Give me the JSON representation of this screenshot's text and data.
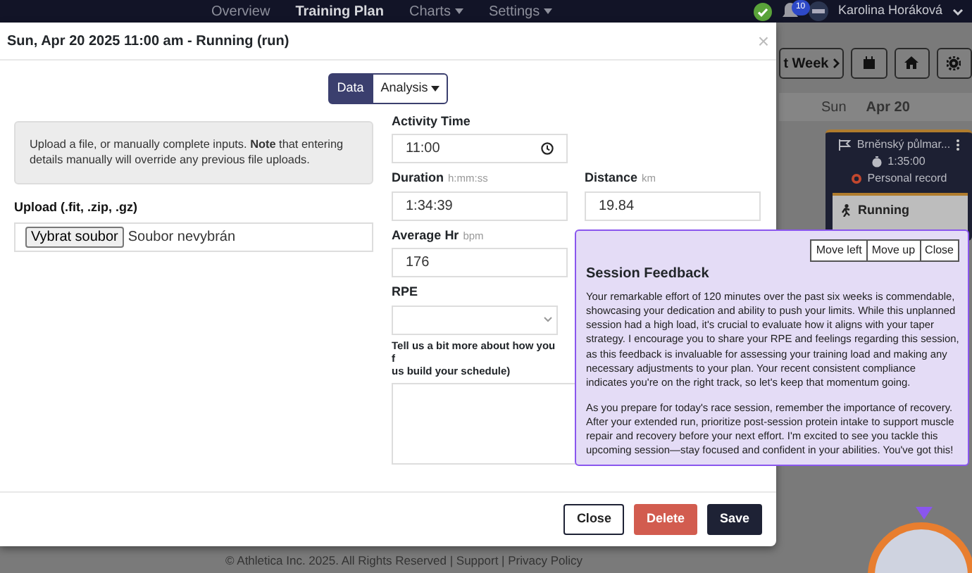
{
  "navbar": {
    "links": [
      {
        "label": "Overview",
        "selected": false,
        "dropdown": false
      },
      {
        "label": "Training Plan",
        "selected": true,
        "dropdown": false
      },
      {
        "label": "Charts",
        "selected": false,
        "dropdown": true
      },
      {
        "label": "Settings",
        "selected": false,
        "dropdown": true
      }
    ],
    "notifications": "10",
    "user_name": "Karolina Horáková"
  },
  "toolbar": {
    "week_button": "t Week"
  },
  "calendar": {
    "day": "Sun",
    "date": "Apr 20",
    "event": {
      "title": "Brněnský půlmar...",
      "duration": "1:35:00",
      "record": "Personal record"
    },
    "session": {
      "title": "Running"
    }
  },
  "modal": {
    "title": "Sun, Apr 20 2025 11:00 am - Running (run)",
    "close_symbol": "×",
    "view_tabs": [
      {
        "label": "Data",
        "selected": true,
        "dropdown": false
      },
      {
        "label": "Analysis",
        "selected": false,
        "dropdown": true
      }
    ],
    "notice": "Upload a file, or manually complete inputs. **Note** that entering details manually will override any previous file uploads.",
    "upload": {
      "label": "Upload (.fit, .zip, .gz)",
      "button": "Vybrat soubor",
      "status": "Soubor nevybrán"
    },
    "field_rows": [
      [
        {
          "kind": "time",
          "label": "Activity Time",
          "value": "11:00"
        }
      ],
      [
        {
          "kind": "text",
          "label": "Duration",
          "unit": "h:mm:ss",
          "value": "1:34:39"
        },
        {
          "kind": "text",
          "label": "Distance",
          "unit": "km",
          "value": "19.84"
        }
      ],
      [
        {
          "kind": "text",
          "label": "Average Hr",
          "unit": "bpm",
          "value": "176"
        }
      ],
      [
        {
          "kind": "select",
          "label": "RPE"
        }
      ],
      [
        {
          "kind": "textarea",
          "label_lines": [
            "Tell us a bit more about how you f",
            "us build your schedule)"
          ]
        }
      ]
    ],
    "buttons": [
      {
        "label": "Close",
        "kind": "outline"
      },
      {
        "label": "Delete",
        "kind": "danger"
      },
      {
        "label": "Save",
        "kind": "primary"
      }
    ]
  },
  "feedback": {
    "buttons": [
      "Move left",
      "Move up",
      "Close"
    ],
    "title": "Session Feedback",
    "paragraphs": [
      "Your remarkable effort of 120 minutes over the past six weeks is commendable, showcasing your dedication and ability to push your limits. While this unplanned session had a high load, it's crucial to evaluate how it aligns with your taper strategy. I encourage you to share your RPE and feelings regarding this session, as this feedback is invaluable for assessing your training load and making any necessary adjustments to your plan. Your recent consistent compliance indicates you're on the right track, so let's keep that momentum going.",
      "As you prepare for today's race session, remember the importance of recovery. After your extended run, prioritize post-session protein intake to support muscle repair and recovery before your next effort. I'm excited to see you tackle this upcoming session—stay focused and confident in your abilities. You've got this!"
    ]
  },
  "footer": "© Athletica Inc. 2025. All Rights Reserved | Support | Privacy Policy"
}
